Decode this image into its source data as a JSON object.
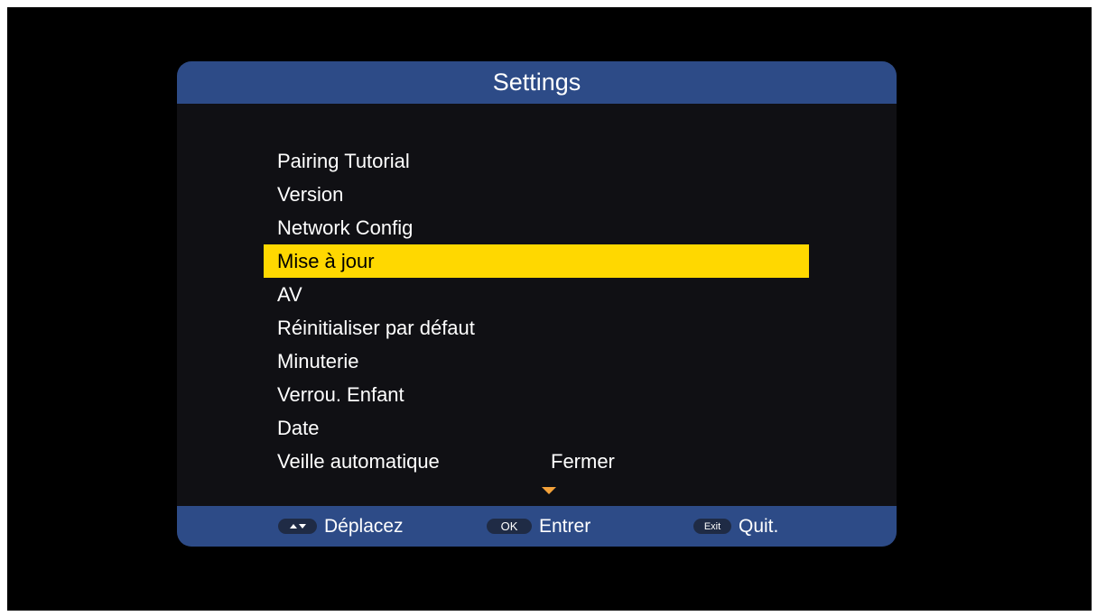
{
  "panel": {
    "title": "Settings"
  },
  "menu": {
    "items": [
      {
        "label": "Pairing Tutorial",
        "value": ""
      },
      {
        "label": "Version",
        "value": ""
      },
      {
        "label": "Network Config",
        "value": ""
      },
      {
        "label": "Mise à jour",
        "value": "",
        "selected": true
      },
      {
        "label": "AV",
        "value": ""
      },
      {
        "label": "Réinitialiser par défaut",
        "value": ""
      },
      {
        "label": "Minuterie",
        "value": ""
      },
      {
        "label": "Verrou. Enfant",
        "value": ""
      },
      {
        "label": "Date",
        "value": ""
      },
      {
        "label": "Veille automatique",
        "value": "Fermer"
      }
    ],
    "scroll_icon": "chevron-down-icon"
  },
  "footer": {
    "move": {
      "key_icon": "up-down-arrows-icon",
      "label": "Déplacez"
    },
    "enter": {
      "key": "OK",
      "label": "Entrer"
    },
    "quit": {
      "key": "Exit",
      "label": "Quit."
    }
  },
  "colors": {
    "screen_background": "#000000",
    "panel_background": "#101014",
    "header_footer": "#2d4b87",
    "selection": "#ffd800",
    "scroll_arrow": "#f4a23a"
  }
}
